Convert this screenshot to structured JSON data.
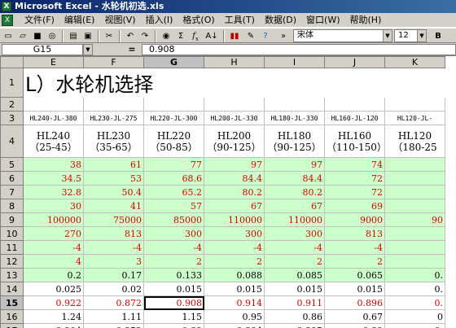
{
  "window": {
    "title": "Microsoft Excel - 水轮机初选.xls",
    "app_icon": "X"
  },
  "menu": [
    "文件(F)",
    "编辑(E)",
    "视图(V)",
    "插入(I)",
    "格式(O)",
    "工具(T)",
    "数据(D)",
    "窗口(W)",
    "帮助(H)"
  ],
  "toolbar": {
    "font_name": "宋体",
    "font_size": "12",
    "bold_label": "B",
    "sigma": "Σ",
    "fx": "f",
    "fx_sub": "x",
    "sort": "A↓",
    "chart": "▮▮",
    "undo": "↶",
    "redo": "↷",
    "help": "?"
  },
  "formula_bar": {
    "cell": "G15",
    "equals": "=",
    "value": "0.908"
  },
  "columns": [
    "E",
    "F",
    "G",
    "H",
    "I",
    "J",
    "K"
  ],
  "selected_column": "G",
  "rows": [
    "1",
    "2",
    "3",
    "4",
    "5",
    "6",
    "7",
    "8",
    "9",
    "10",
    "11",
    "12",
    "13",
    "14",
    "15",
    "16",
    "17"
  ],
  "selected_row": "15",
  "sheet": {
    "title": "L）水轮机选择",
    "codes": [
      "HL240-JL-380",
      "HL230-JL-275",
      "HL220-JL-300",
      "HL200-JL-330",
      "HL180-JL-330",
      "HL160-JL-120",
      "HL120-JL-"
    ],
    "models": [
      "HL240",
      "HL230",
      "HL220",
      "HL200",
      "HL180",
      "HL160",
      "HL120"
    ],
    "ranges": [
      "（25-45）",
      "（35-65）",
      "（50-85）",
      "（90-125）",
      "（90-125）",
      "（110-150）",
      "（180-25"
    ],
    "data": [
      [
        "38",
        "61",
        "77",
        "97",
        "97",
        "74",
        ""
      ],
      [
        "34.5",
        "53",
        "68.6",
        "84.4",
        "84.4",
        "72",
        ""
      ],
      [
        "32.8",
        "50.4",
        "65.2",
        "80.2",
        "80.2",
        "72",
        ""
      ],
      [
        "30",
        "41",
        "57",
        "67",
        "67",
        "69",
        ""
      ],
      [
        "100000",
        "75000",
        "85000",
        "110000",
        "110000",
        "9000",
        "90"
      ],
      [
        "270",
        "813",
        "300",
        "300",
        "300",
        "813",
        ""
      ],
      [
        "-4",
        "-4",
        "-4",
        "-4",
        "-4",
        "-4",
        ""
      ],
      [
        "4",
        "3",
        "2",
        "2",
        "2",
        "2",
        ""
      ],
      [
        "0.2",
        "0.17",
        "0.133",
        "0.088",
        "0.085",
        "0.065",
        "0."
      ],
      [
        "0.025",
        "0.02",
        "0.015",
        "0.015",
        "0.015",
        "0.015",
        "0."
      ],
      [
        "0.922",
        "0.872",
        "0.908",
        "0.914",
        "0.911",
        "0.896",
        "0."
      ],
      [
        "1.24",
        "1.11",
        "1.15",
        "0.95",
        "0.86",
        "0.67",
        "0"
      ],
      [
        "0.904",
        "0.852",
        "0.89",
        "0.894",
        "0.895",
        "0.89",
        "0."
      ]
    ]
  },
  "colors": {
    "green_fill": "#ccffcc",
    "red_text": "#e00000",
    "title_bar": "#0a246a"
  }
}
